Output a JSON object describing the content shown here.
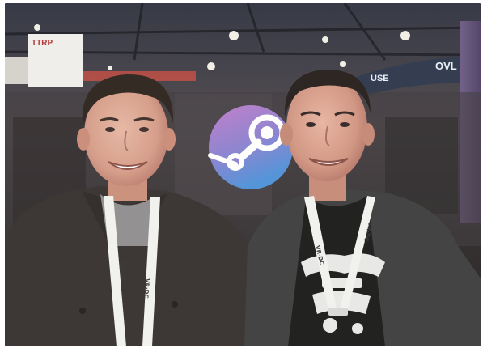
{
  "scene": {
    "description_tags": [
      "photo",
      "two-people",
      "trade-show-booth",
      "steam-logo"
    ],
    "colors": {
      "ceiling": "#2b2e3b",
      "steam_logo_gradient_top": "#b06fbf",
      "steam_logo_gradient_bottom": "#4d8fd6",
      "shirt_dark": "#2e2a2a",
      "cardigan": "#3a3a3c"
    }
  },
  "signs": {
    "left_sign_text": "TTRP",
    "right_sign_text_top": "OVL",
    "right_sign_text_bottom": "USE"
  },
  "lanyards": {
    "left_text": "VR·DC",
    "right_text": "VR·DC"
  }
}
